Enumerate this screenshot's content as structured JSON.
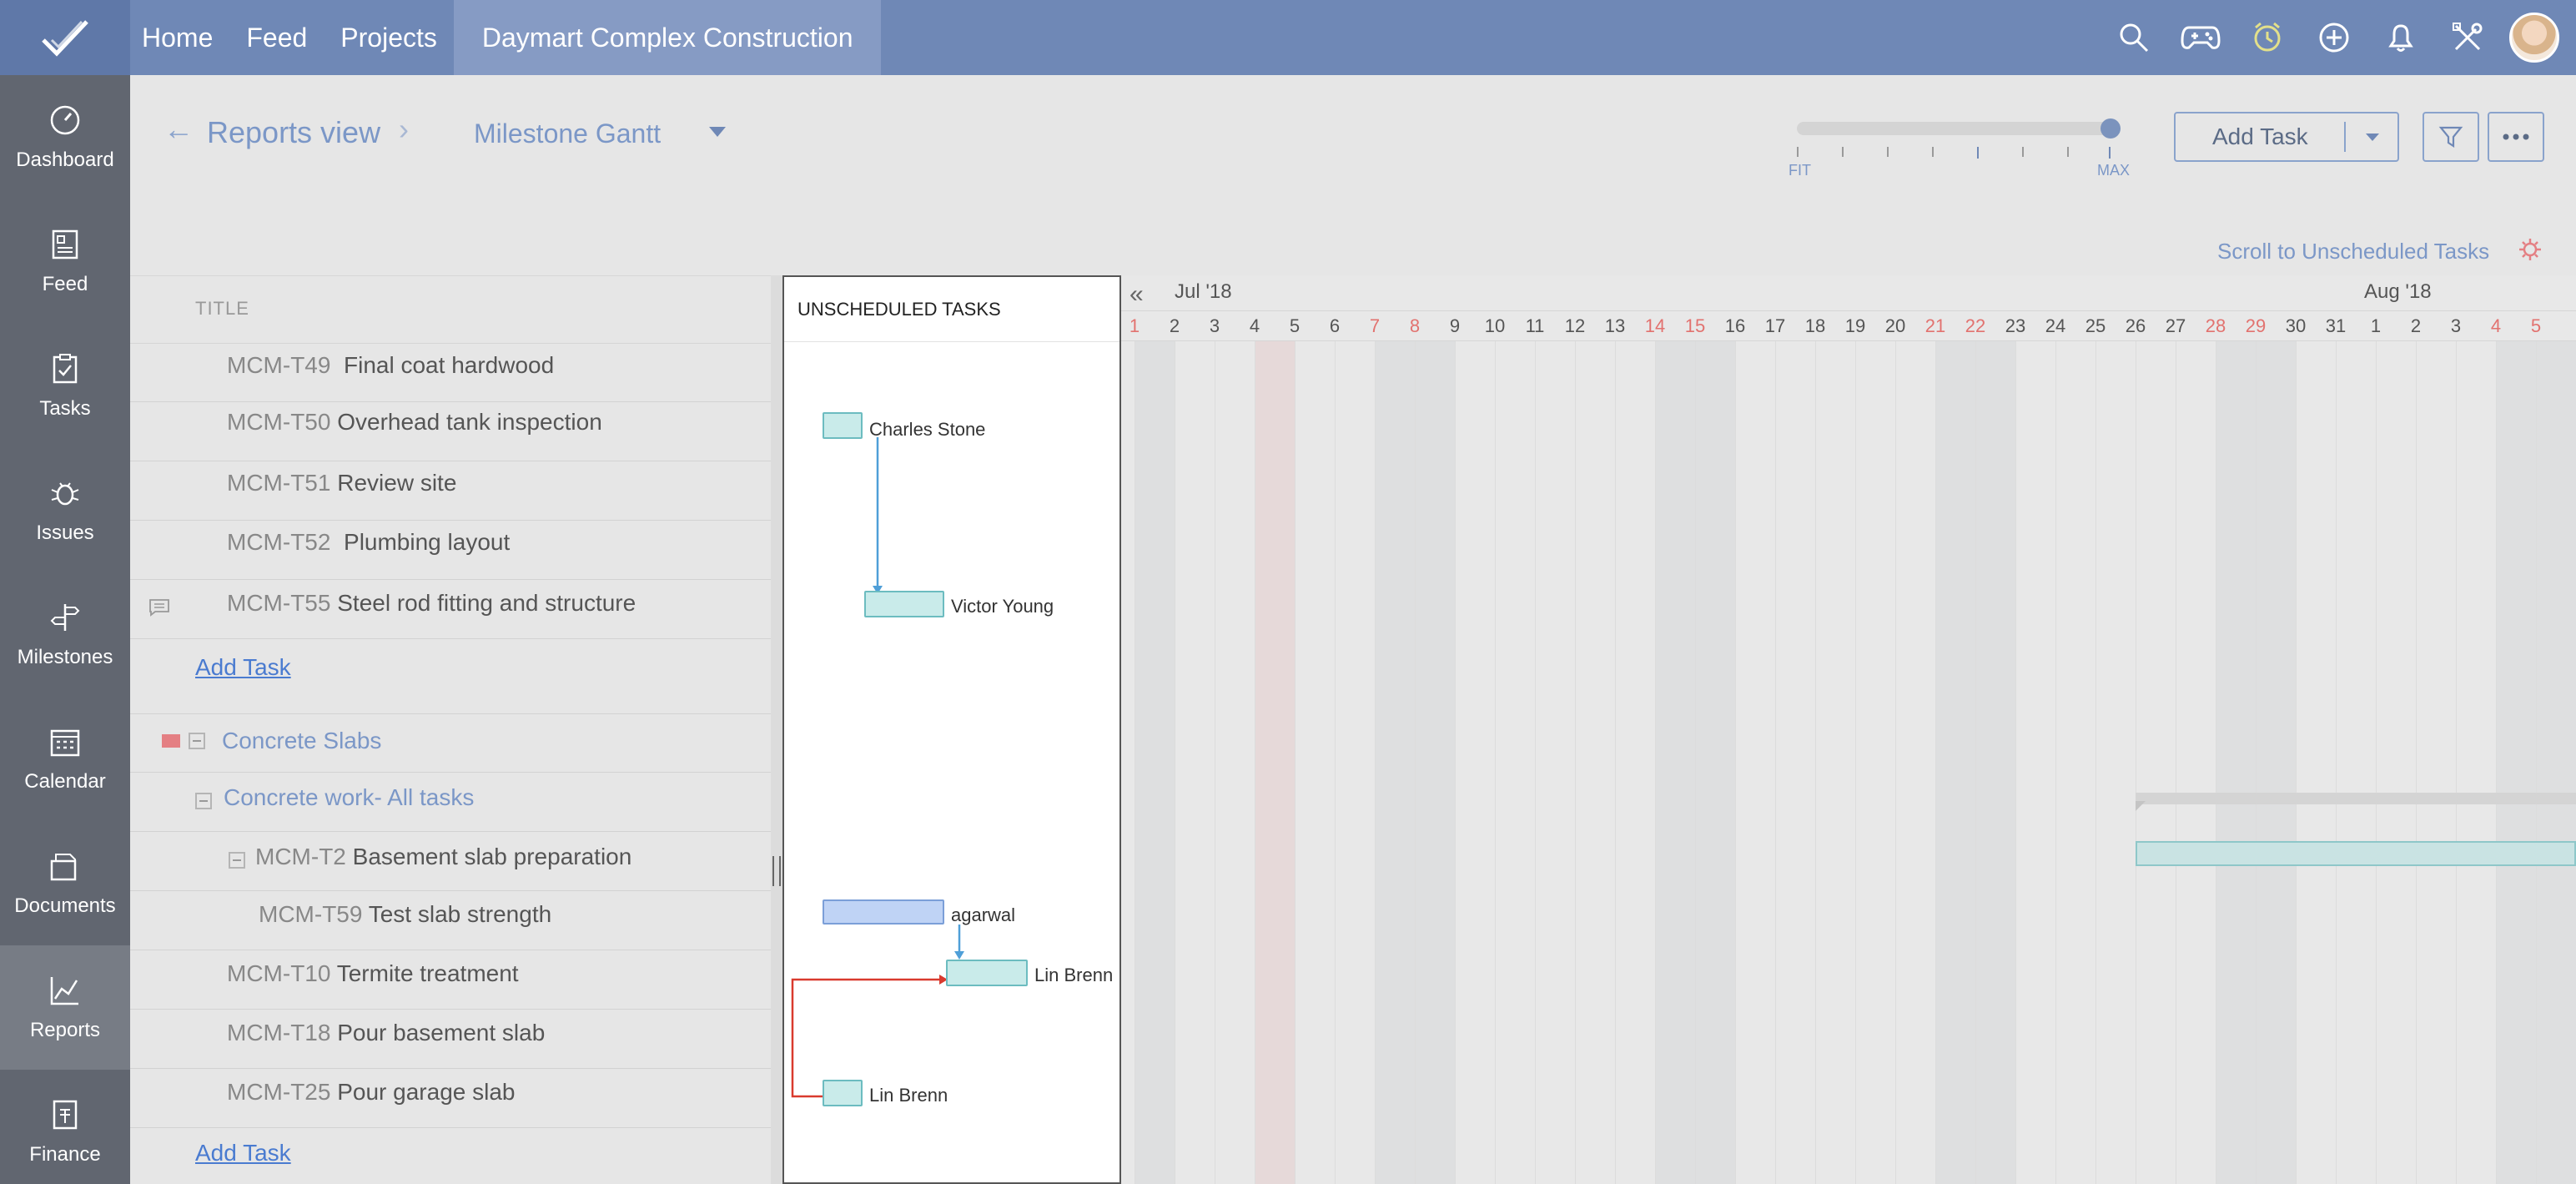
{
  "topbar": {
    "nav": [
      "Home",
      "Feed",
      "Projects"
    ],
    "project": "Daymart Complex Construction",
    "icons": [
      "search-icon",
      "gamepad-icon",
      "timer-icon",
      "add-circle-icon",
      "bell-icon",
      "tools-icon"
    ]
  },
  "sidebar": {
    "items": [
      {
        "label": "Dashboard",
        "icon": "dashboard-icon"
      },
      {
        "label": "Feed",
        "icon": "feed-icon"
      },
      {
        "label": "Tasks",
        "icon": "tasks-icon"
      },
      {
        "label": "Issues",
        "icon": "bug-icon"
      },
      {
        "label": "Milestones",
        "icon": "signpost-icon"
      },
      {
        "label": "Calendar",
        "icon": "calendar-icon"
      },
      {
        "label": "Documents",
        "icon": "documents-icon"
      },
      {
        "label": "Reports",
        "icon": "reports-icon"
      },
      {
        "label": "Finance",
        "icon": "finance-icon"
      }
    ]
  },
  "header": {
    "breadcrumb": "Reports view",
    "view": "Milestone Gantt",
    "zoom": {
      "min_label": "FIT",
      "max_label": "MAX",
      "level": 1.0
    },
    "add_task": "Add Task",
    "scroll_link": "Scroll to Unscheduled Tasks"
  },
  "grid": {
    "title_header": "TITLE",
    "rows": [
      {
        "code": "MCM-T49",
        "title": "Final coat hardwood"
      },
      {
        "code": "MCM-T50",
        "title": "Overhead tank inspection"
      },
      {
        "code": "MCM-T51",
        "title": "Review site"
      },
      {
        "code": "MCM-T52",
        "title": "Plumbing layout"
      },
      {
        "code": "MCM-T55",
        "title": "Steel rod fitting and structure"
      }
    ],
    "add_task_1": "Add Task",
    "milestone": "Concrete Slabs",
    "tasklist": "Concrete work- All tasks",
    "parent_task": {
      "code": "MCM-T2",
      "title": "Basement slab preparation"
    },
    "subtask": {
      "code": "MCM-T59",
      "title": "Test slab strength"
    },
    "rows2": [
      {
        "code": "MCM-T10",
        "title": "Termite treatment"
      },
      {
        "code": "MCM-T18",
        "title": "Pour basement slab"
      },
      {
        "code": "MCM-T25",
        "title": "Pour garage slab"
      }
    ],
    "add_task_2": "Add Task"
  },
  "unscheduled": {
    "title": "UNSCHEDULED TASKS",
    "labels": [
      "Charles Stone",
      "Victor Young",
      "agarwal",
      "Lin Brenn",
      "Lin Brenn"
    ]
  },
  "gantt": {
    "months": [
      "Jul '18",
      "Aug '18"
    ],
    "days": [
      "1",
      "2",
      "3",
      "4",
      "5",
      "6",
      "7",
      "8",
      "9",
      "10",
      "11",
      "12",
      "13",
      "14",
      "15",
      "16",
      "17",
      "18",
      "19",
      "20",
      "21",
      "22",
      "23",
      "24",
      "25",
      "26",
      "27",
      "28",
      "29",
      "30",
      "31",
      "1",
      "2",
      "3",
      "4",
      "5"
    ],
    "weekend_days": [
      "1",
      "7",
      "8",
      "14",
      "15",
      "21",
      "22",
      "28",
      "29",
      "4",
      "5"
    ],
    "colors": {
      "weekend_text": "#e2726f",
      "accent": "#6f88b6",
      "bar": "#c9ebea"
    }
  }
}
